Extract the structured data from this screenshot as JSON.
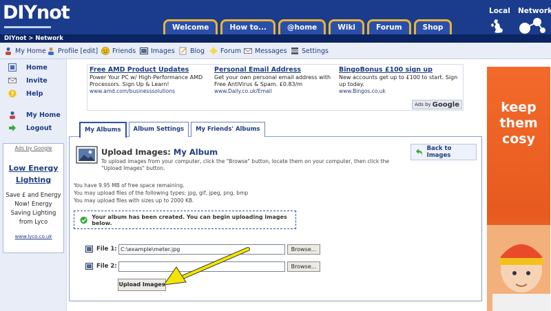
{
  "header": {
    "logo": "DIYnot",
    "nav": [
      "Welcome",
      "How to...",
      "@home",
      "Wiki",
      "Forum",
      "Shop"
    ],
    "local": "Local",
    "network": "Network"
  },
  "breadcrumb": "DIYnot > Network",
  "toolbar": {
    "items": [
      {
        "label": "My Home",
        "icon": "home-icon"
      },
      {
        "label": "Profile [edit]",
        "icon": "profile-icon"
      },
      {
        "label": "Friends",
        "icon": "smiley-icon"
      },
      {
        "label": "Images",
        "icon": "images-icon"
      },
      {
        "label": "Blog",
        "icon": "blog-icon"
      },
      {
        "label": "Forum",
        "icon": "forum-icon"
      },
      {
        "label": "Messages",
        "icon": "messages-icon"
      },
      {
        "label": "Settings",
        "icon": "settings-icon"
      }
    ]
  },
  "sidebar": {
    "items": [
      {
        "label": "Home",
        "icon": "home-icon"
      },
      {
        "label": "Invite",
        "icon": "invite-icon"
      },
      {
        "label": "Help",
        "icon": "help-icon"
      },
      {
        "label": "My Home",
        "icon": "user-icon"
      },
      {
        "label": "Logout",
        "icon": "logout-icon"
      }
    ],
    "ad": {
      "ads_by": "Ads by Google",
      "title": "Low Energy Lighting",
      "text": "Save £ and Energy Now! Energy Saving Lighting from Lyco",
      "url": "www.lyco.co.uk"
    }
  },
  "top_ads": {
    "items": [
      {
        "title": "Free AMD Product Updates",
        "text": "Power Your PC w/ High-Performance AMD Processors. Sign Up & Learn!",
        "url": "www.amd.com/businesssolutions"
      },
      {
        "title": "Personal Email Address",
        "text": "Get your own personal email address with Free AntiVirus & Spam. £0.83/m",
        "url": "www.Daily.co.uk/Email"
      },
      {
        "title": "BingoBonus £100 sign up",
        "text": "New accounts get up to £100 to start. Sign up today.",
        "url": "www.Bingos.co.uk"
      }
    ],
    "ads_by": "Ads by",
    "google": "Google"
  },
  "tabs": [
    "My Albums",
    "Album Settings",
    "My Friends' Albums"
  ],
  "upload": {
    "title_prefix": "Upload Images:",
    "album": "My Album",
    "description": "To upload images from your computer, click the \"Browse\" button, locate them on your computer, then click the \"Upload Images\" button.",
    "back_label": "Back to Images",
    "info": [
      "You have 9.95 MB of free space remaining.",
      "You may upload files of the following types: jpg, gif, jpeg, png, bmp",
      "You may upload files with sizes up to 2000 KB."
    ],
    "notice": "Your album has been created. You can begin uploading images below.",
    "files": [
      {
        "label": "File 1:",
        "value": "C:\\example\\meter.jpg"
      },
      {
        "label": "File 2:",
        "value": ""
      }
    ],
    "browse_label": "Browse...",
    "upload_label": "Upload Images"
  },
  "right_ad": {
    "text": "keep them cosy"
  },
  "colors": {
    "header": "#1b3c8c",
    "tab_border": "#e9b437",
    "link": "#1f3b82",
    "arrow": "#f2e600"
  }
}
